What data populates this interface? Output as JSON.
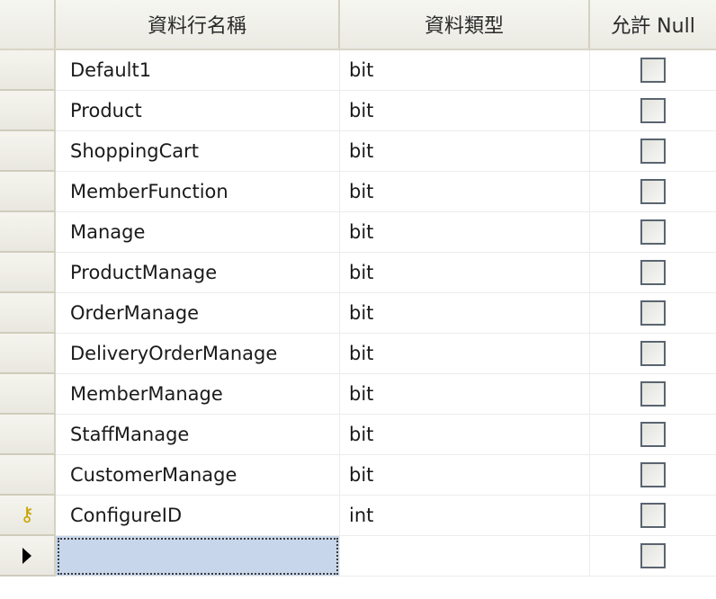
{
  "table": {
    "headers": {
      "column_name": "資料行名稱",
      "data_type": "資料類型",
      "allow_null": "允許 Null"
    },
    "rows": [
      {
        "name": "Default1",
        "type": "bit",
        "allow_null": false
      },
      {
        "name": "Product",
        "type": "bit",
        "allow_null": false
      },
      {
        "name": "ShoppingCart",
        "type": "bit",
        "allow_null": false
      },
      {
        "name": "MemberFunction",
        "type": "bit",
        "allow_null": false
      },
      {
        "name": "Manage",
        "type": "bit",
        "allow_null": false
      },
      {
        "name": "ProductManage",
        "type": "bit",
        "allow_null": false
      },
      {
        "name": "OrderManage",
        "type": "bit",
        "allow_null": false
      },
      {
        "name": "DeliveryOrderManage",
        "type": "bit",
        "allow_null": false
      },
      {
        "name": "MemberManage",
        "type": "bit",
        "allow_null": false
      },
      {
        "name": "StaffManage",
        "type": "bit",
        "allow_null": false
      },
      {
        "name": "CustomerManage",
        "type": "bit",
        "allow_null": false
      },
      {
        "name": "ConfigureID",
        "type": "int",
        "allow_null": false,
        "primary_key": true
      }
    ],
    "new_row": {
      "name": "",
      "type": "",
      "allow_null": false
    }
  },
  "icons": {
    "primary_key": "key-icon",
    "current_row": "arrow-right-icon"
  },
  "colors": {
    "new_row_highlight": "#c7d6ea",
    "key_icon": "#c9a400"
  }
}
